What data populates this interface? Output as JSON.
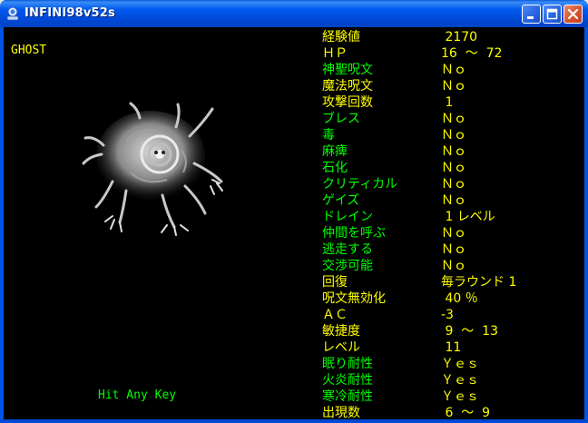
{
  "window": {
    "title": "INFINI98v52s"
  },
  "colors": {
    "label_green": "#00ff00",
    "label_yellow": "#ffff00",
    "value_yellow": "#ffff00",
    "background": "#000000"
  },
  "monster": {
    "name": "GHOST",
    "image": "ghost-monster-picture"
  },
  "footer": {
    "prompt": "Hit Any Key"
  },
  "stats": [
    {
      "label": "経験値",
      "value": " 2170",
      "label_color": "yellow"
    },
    {
      "label": "ＨＰ",
      "value": "16  ～  72",
      "label_color": "yellow"
    },
    {
      "label": "神聖呪文",
      "value": "Ｎｏ",
      "label_color": "green"
    },
    {
      "label": "魔法呪文",
      "value": "Ｎｏ",
      "label_color": "yellow"
    },
    {
      "label": "攻撃回数",
      "value": " 1",
      "label_color": "yellow"
    },
    {
      "label": "ブレス",
      "value": "Ｎｏ",
      "label_color": "green"
    },
    {
      "label": "毒",
      "value": "Ｎｏ",
      "label_color": "green"
    },
    {
      "label": "麻痺",
      "value": "Ｎｏ",
      "label_color": "green"
    },
    {
      "label": "石化",
      "value": "Ｎｏ",
      "label_color": "green"
    },
    {
      "label": "クリティカル",
      "value": "Ｎｏ",
      "label_color": "green"
    },
    {
      "label": "ゲイズ",
      "value": "Ｎｏ",
      "label_color": "green"
    },
    {
      "label": "ドレイン",
      "value": " 1 レベル",
      "label_color": "green"
    },
    {
      "label": "仲間を呼ぶ",
      "value": "Ｎｏ",
      "label_color": "green"
    },
    {
      "label": "逃走する",
      "value": "Ｎｏ",
      "label_color": "green"
    },
    {
      "label": "交渉可能",
      "value": "Ｎｏ",
      "label_color": "green"
    },
    {
      "label": "回復",
      "value": "毎ラウンド 1",
      "label_color": "yellow"
    },
    {
      "label": "呪文無効化",
      "value": " 40 ％",
      "label_color": "yellow"
    },
    {
      "label": "ＡＣ",
      "value": "-3",
      "label_color": "yellow"
    },
    {
      "label": "敏捷度",
      "value": " 9  ～  13",
      "label_color": "yellow"
    },
    {
      "label": "レベル",
      "value": " 11",
      "label_color": "yellow"
    },
    {
      "label": "眠り耐性",
      "value": "Ｙｅｓ",
      "label_color": "green"
    },
    {
      "label": "火炎耐性",
      "value": "Ｙｅｓ",
      "label_color": "green"
    },
    {
      "label": "寒冷耐性",
      "value": "Ｙｅｓ",
      "label_color": "green"
    },
    {
      "label": "出現数",
      "value": " 6  ～  9",
      "label_color": "yellow"
    }
  ]
}
